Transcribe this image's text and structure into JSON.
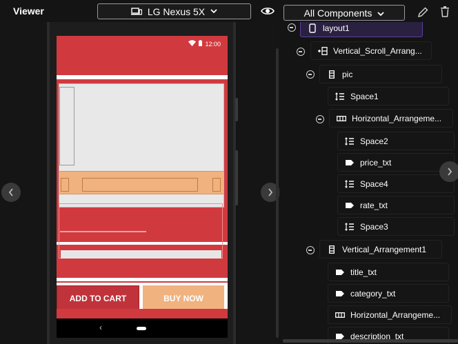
{
  "app": {
    "viewer_label": "Viewer",
    "device_select": "LG Nexus 5X",
    "components_select": "All Components"
  },
  "icons": {
    "device": "device-icon",
    "chevron": "chevron-down-icon",
    "eye": "eye-icon",
    "pencil": "pencil-icon",
    "trash": "trash-icon"
  },
  "phone": {
    "time": "12:00",
    "add_to_cart": "ADD TO CART",
    "buy_now": "BUY NOW",
    "nav_back": "‹"
  },
  "tree": {
    "items": [
      {
        "label": "layout1",
        "icon": "phone-icon",
        "selected": true
      },
      {
        "label": "Vertical_Scroll_Arrang...",
        "icon": "vertical-scroll-icon"
      },
      {
        "label": "pic",
        "icon": "vertical-arrangement-icon"
      },
      {
        "label": "Space1",
        "icon": "space-icon"
      },
      {
        "label": "Horizontal_Arrangeme...",
        "icon": "horizontal-arrangement-icon"
      },
      {
        "label": "Space2",
        "icon": "space-icon"
      },
      {
        "label": "price_txt",
        "icon": "label-icon"
      },
      {
        "label": "Space4",
        "icon": "space-icon"
      },
      {
        "label": "rate_txt",
        "icon": "label-icon"
      },
      {
        "label": "Space3",
        "icon": "space-icon"
      },
      {
        "label": "Vertical_Arrangement1",
        "icon": "vertical-arrangement-icon"
      },
      {
        "label": "title_txt",
        "icon": "label-icon"
      },
      {
        "label": "category_txt",
        "icon": "label-icon"
      },
      {
        "label": "Horizontal_Arrangeme...",
        "icon": "horizontal-arrangement-icon"
      },
      {
        "label": "description_txt",
        "icon": "label-icon"
      }
    ]
  },
  "colors": {
    "primary_red": "#d03a3f",
    "accent_orange": "#f0b27f",
    "selected_row": "#2a2140"
  }
}
